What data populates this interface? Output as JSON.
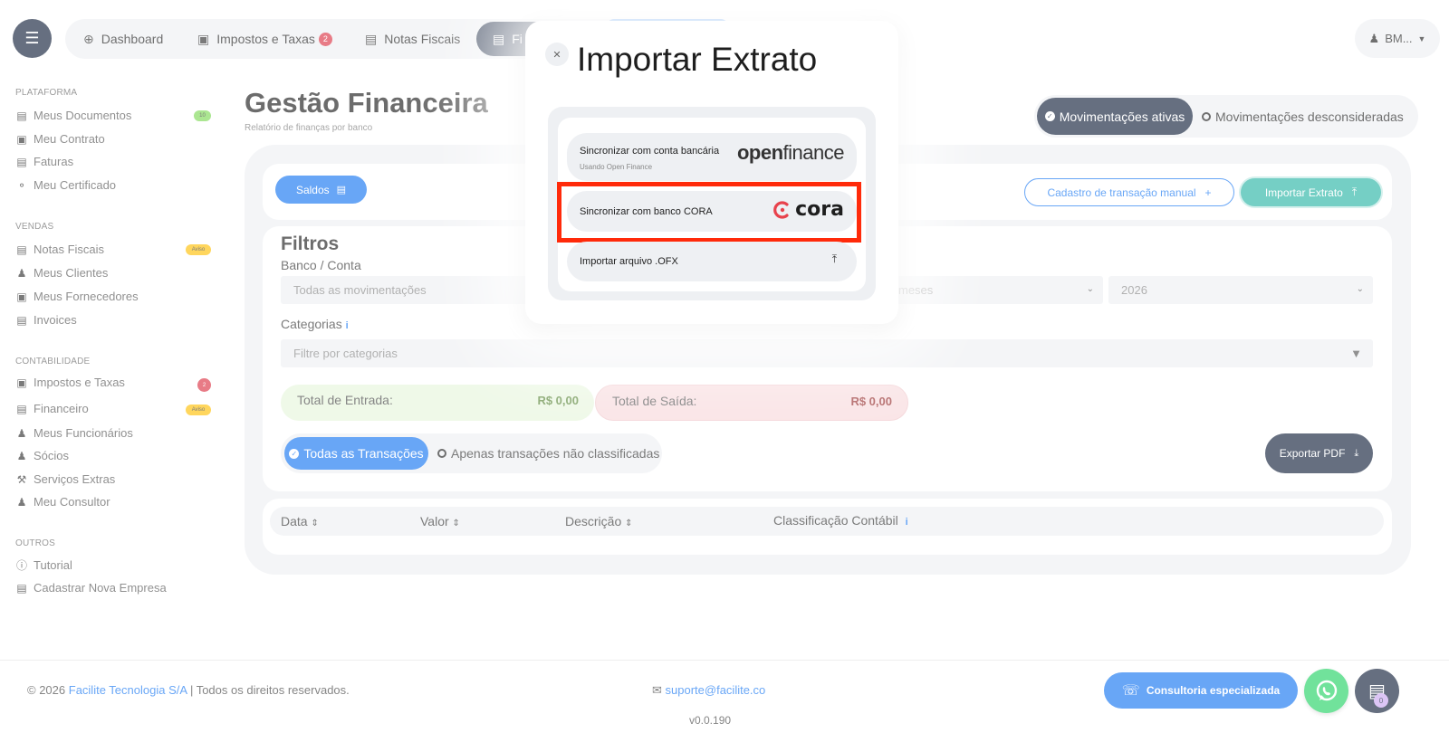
{
  "topnav": {
    "menu_icon": "hamburger-icon",
    "items": [
      {
        "label": "Dashboard",
        "icon": "globe-icon"
      },
      {
        "label": "Impostos e Taxas",
        "icon": "tax-icon",
        "badge": "2"
      },
      {
        "label": "Notas Fiscais",
        "icon": "invoice-icon"
      }
    ],
    "active_item": {
      "label": "Fi",
      "icon": "finance-icon"
    },
    "user": {
      "label": "BM...",
      "icon": "user-icon"
    }
  },
  "sidebar": {
    "sections": [
      {
        "title": "PLATAFORMA",
        "items": [
          {
            "label": "Meus Documentos",
            "pill": "10"
          },
          {
            "label": "Meu Contrato"
          },
          {
            "label": "Faturas"
          },
          {
            "label": "Meu Certificado"
          }
        ]
      },
      {
        "title": "VENDAS",
        "items": [
          {
            "label": "Notas Fiscais",
            "pill": "Aviso"
          },
          {
            "label": "Meus Clientes"
          },
          {
            "label": "Meus Fornecedores"
          },
          {
            "label": "Invoices"
          }
        ]
      },
      {
        "title": "CONTABILIDADE",
        "items": [
          {
            "label": "Impostos e Taxas",
            "pill": "2"
          },
          {
            "label": "Financeiro",
            "pill": "Aviso"
          },
          {
            "label": "Meus Funcionários"
          },
          {
            "label": "Sócios"
          },
          {
            "label": "Serviços Extras"
          },
          {
            "label": "Meu Consultor"
          }
        ]
      },
      {
        "title": "OUTROS",
        "items": [
          {
            "label": "Tutorial"
          },
          {
            "label": "Cadastrar Nova Empresa"
          }
        ]
      }
    ]
  },
  "main": {
    "title": "Gestão Financeira",
    "subtitle": "Relatório de finanças por banco",
    "toggle": {
      "on": "Movimentações ativas",
      "off": "Movimentações desconsideradas"
    },
    "saldos_label": "Saldos",
    "cadastro_label": "Cadastro de transação manual",
    "importar_label": "Importar Extrato",
    "filters": {
      "title": "Filtros",
      "banco_label": "Banco / Conta",
      "banco_value": "Todas as movimentações",
      "meses_value": "meses",
      "ano_value": "2026",
      "categorias_label": "Categorias",
      "categorias_placeholder": "Filtre por categorias"
    },
    "totals": {
      "in_label": "Total de Entrada:",
      "in_value": "R$ 0,00",
      "out_label": "Total de Saída:",
      "out_value": "R$ 0,00"
    },
    "tx_toggle": {
      "on": "Todas as Transações",
      "off": "Apenas transações não classificadas"
    },
    "export_label": "Exportar PDF",
    "table_headers": [
      "Data",
      "Valor",
      "Descrição",
      "Classificação Contábil"
    ]
  },
  "footer": {
    "copyright_prefix": "© 2026",
    "company": "Facilite Tecnologia S/A",
    "rights": "| Todos os direitos reservados.",
    "email": "suporte@facilite.co",
    "version": "v0.0.190",
    "consult_label": "Consultoria especializada",
    "doc_badge": "0"
  },
  "modal": {
    "title": "Importar Extrato",
    "close_icon": "close-icon",
    "options": [
      {
        "label": "Sincronizar com conta bancária",
        "sub": "Usando Open Finance",
        "logo": "openfinance"
      },
      {
        "label": "Sincronizar com banco CORA",
        "logo": "cora"
      },
      {
        "label": "Importar arquivo .OFX",
        "icon": "upload-icon"
      }
    ],
    "logo_open": "open",
    "logo_finance": "finance",
    "logo_cora": "cora"
  },
  "colors": {
    "navy": "#15233d",
    "blue": "#1877f2",
    "teal": "#2bb5a6",
    "highlight": "#ff2a0a",
    "cora": "#e8424c"
  }
}
